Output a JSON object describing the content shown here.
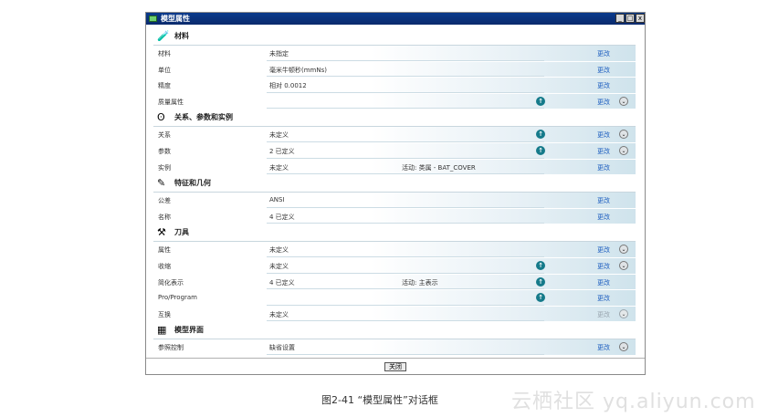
{
  "window": {
    "title": "模型属性",
    "buttons": [
      "_",
      "□",
      "x"
    ]
  },
  "sections": [
    {
      "title": "材料",
      "icon": "material-icon",
      "rows": [
        {
          "label": "材料",
          "value": "未指定",
          "extra": "",
          "info": false,
          "change": "更改",
          "change_enabled": true,
          "expand": false
        },
        {
          "label": "单位",
          "value": "毫米牛顿秒(mmNs)",
          "extra": "",
          "info": false,
          "change": "更改",
          "change_enabled": true,
          "expand": false
        },
        {
          "label": "精度",
          "value": "相对 0.0012",
          "extra": "",
          "info": false,
          "change": "更改",
          "change_enabled": true,
          "expand": false
        },
        {
          "label": "质量属性",
          "value": "",
          "extra": "",
          "info": true,
          "change": "更改",
          "change_enabled": true,
          "expand": true
        }
      ]
    },
    {
      "title": "关系、参数和实例",
      "icon": "relations-icon",
      "rows": [
        {
          "label": "关系",
          "value": "未定义",
          "extra": "",
          "info": true,
          "change": "更改",
          "change_enabled": true,
          "expand": true
        },
        {
          "label": "参数",
          "value": "2 已定义",
          "extra": "",
          "info": true,
          "change": "更改",
          "change_enabled": true,
          "expand": true
        },
        {
          "label": "实例",
          "value": "未定义",
          "extra": "活动: 类属 - BAT_COVER",
          "info": false,
          "change": "更改",
          "change_enabled": true,
          "expand": false
        }
      ]
    },
    {
      "title": "特征和几何",
      "icon": "feature-icon",
      "rows": [
        {
          "label": "公差",
          "value": "ANSI",
          "extra": "",
          "info": false,
          "change": "更改",
          "change_enabled": true,
          "expand": false
        },
        {
          "label": "名称",
          "value": "4 已定义",
          "extra": "",
          "info": false,
          "change": "更改",
          "change_enabled": true,
          "expand": false
        }
      ]
    },
    {
      "title": "刀具",
      "icon": "tool-icon",
      "rows": [
        {
          "label": "属性",
          "value": "未定义",
          "extra": "",
          "info": false,
          "change": "更改",
          "change_enabled": true,
          "expand": true
        },
        {
          "label": "收缩",
          "value": "未定义",
          "extra": "",
          "info": true,
          "change": "更改",
          "change_enabled": true,
          "expand": true
        },
        {
          "label": "简化表示",
          "value": "4 已定义",
          "extra": "活动: 主表示",
          "info": true,
          "change": "更改",
          "change_enabled": true,
          "expand": false
        },
        {
          "label": "Pro/Program",
          "value": "",
          "extra": "",
          "info": true,
          "change": "更改",
          "change_enabled": true,
          "expand": false
        },
        {
          "label": "互换",
          "value": "未定义",
          "extra": "",
          "info": false,
          "change": "更改",
          "change_enabled": false,
          "expand": true
        }
      ]
    },
    {
      "title": "模型界面",
      "icon": "model-interface-icon",
      "rows": [
        {
          "label": "参照控制",
          "value": "缺省设置",
          "extra": "",
          "info": false,
          "change": "更改",
          "change_enabled": true,
          "expand": true
        }
      ]
    }
  ],
  "footer": {
    "close_label": "关闭"
  },
  "caption": "图2-41 “模型属性”对话框",
  "watermark": "云栖社区 yq.aliyun.com"
}
